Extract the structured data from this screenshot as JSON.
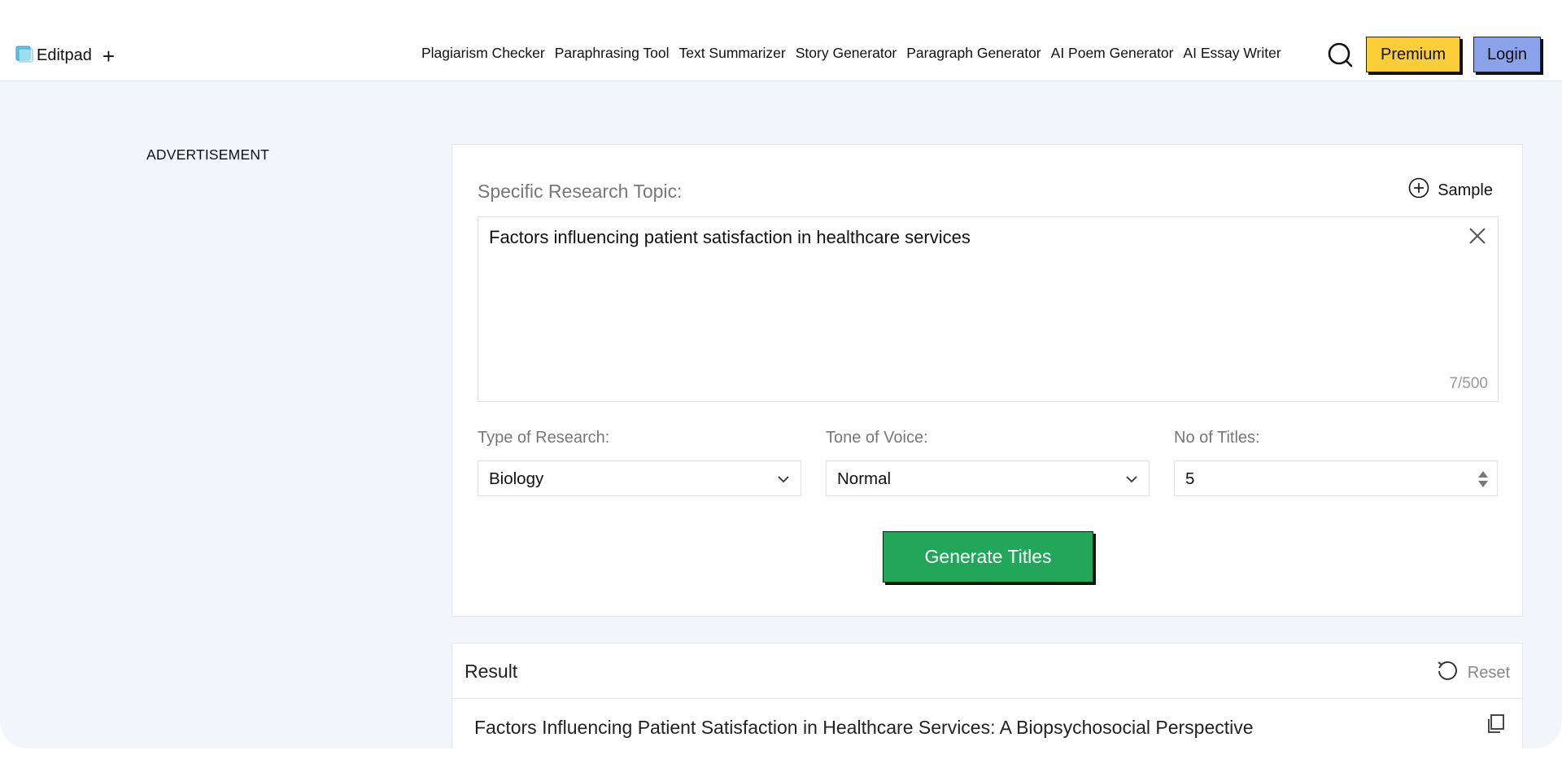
{
  "header": {
    "brand": "Editpad",
    "brand_plus": "+",
    "nav": [
      "Plagiarism Checker",
      "Paraphrasing Tool",
      "Text Summarizer",
      "Story Generator",
      "Paragraph Generator",
      "AI Poem Generator",
      "AI Essay Writer"
    ],
    "premium_label": "Premium",
    "login_label": "Login"
  },
  "advertisement_label": "ADVERTISEMENT",
  "form": {
    "topic_label": "Specific Research Topic:",
    "sample_label": "Sample",
    "topic_value": "Factors influencing patient satisfaction in healthcare services",
    "counter": "7/500",
    "type_label": "Type of Research:",
    "type_value": "Biology",
    "tone_label": "Tone of Voice:",
    "tone_value": "Normal",
    "titles_label": "No of Titles:",
    "titles_value": "5",
    "generate_label": "Generate Titles"
  },
  "result": {
    "title": "Result",
    "reset_label": "Reset",
    "items": [
      "Factors Influencing Patient Satisfaction in Healthcare Services: A Biopsychosocial Perspective"
    ]
  },
  "colors": {
    "premium": "#fbcd39",
    "login": "#8aa2ea",
    "generate": "#22a659",
    "page_bg": "#f2f5fa"
  }
}
